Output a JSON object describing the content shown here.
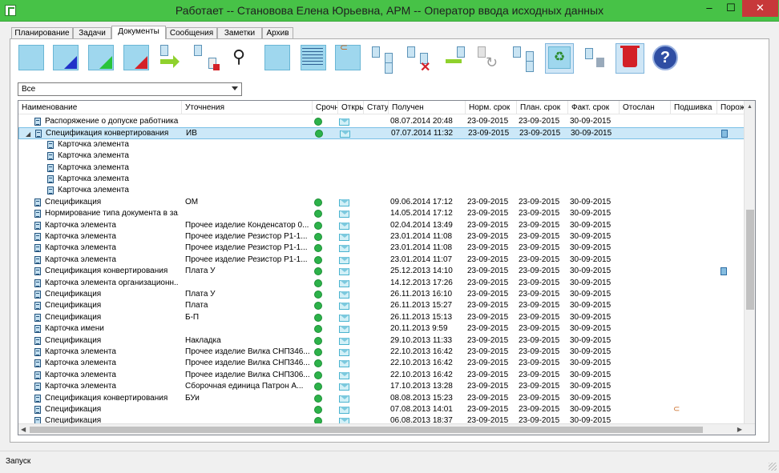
{
  "window": {
    "title": "Работает -- Становова Елена Юрьевна,     АРМ -- Оператор ввода исходных данных",
    "minimize": "–",
    "maximize": "☐",
    "close": "✕"
  },
  "tabs": [
    {
      "label": "Планирование"
    },
    {
      "label": "Задачи"
    },
    {
      "label": "Документы",
      "active": true
    },
    {
      "label": "Сообщения"
    },
    {
      "label": "Заметки"
    },
    {
      "label": "Архив"
    }
  ],
  "toolbar": {
    "icons": [
      "envelope-icon",
      "new-doc-blue-icon",
      "new-doc-green-icon",
      "new-doc-red-icon",
      "send-icon",
      "assign-icon",
      "binoculars-icon",
      "blank-icon",
      "list-icon",
      "attach-icon",
      "route-icon",
      "route-delete-icon",
      "receive-icon",
      "refresh-icon",
      "tree-icon",
      "recycle-icon",
      "trash-small-icon",
      "trash-icon",
      "help-icon"
    ]
  },
  "filter": {
    "value": "Все"
  },
  "grid": {
    "columns": [
      "Наименование",
      "Уточнения",
      "Срочн",
      "Откры",
      "Статус",
      "Получен",
      "Норм. срок",
      "План. срок",
      "Факт. срок",
      "Отослан",
      "Подшивка",
      "Порож"
    ],
    "rows": [
      {
        "name": "Распоряжение о допуске работника ...",
        "spec": "",
        "urgent": true,
        "open": true,
        "received": "08.07.2014 20:48",
        "norm": "23-09-2015",
        "plan": "23-09-2015",
        "fact": "30-09-2015",
        "indent": 1
      },
      {
        "name": "Спецификация конвертирования",
        "spec": "ИВ",
        "urgent": true,
        "open": true,
        "received": "07.07.2014 11:32",
        "norm": "23-09-2015",
        "plan": "23-09-2015",
        "fact": "30-09-2015",
        "indent": 1,
        "selected": true,
        "expanded": true,
        "pair": true
      },
      {
        "name": "Карточка элемента",
        "spec": "",
        "indent": 2
      },
      {
        "name": "Карточка элемента",
        "spec": "",
        "indent": 2
      },
      {
        "name": "Карточка элемента",
        "spec": "",
        "indent": 2
      },
      {
        "name": "Карточка элемента",
        "spec": "",
        "indent": 2
      },
      {
        "name": "Карточка элемента",
        "spec": "",
        "indent": 2
      },
      {
        "name": "Спецификация",
        "spec": "ОМ",
        "urgent": true,
        "open": true,
        "received": "09.06.2014 17:12",
        "norm": "23-09-2015",
        "plan": "23-09-2015",
        "fact": "30-09-2015",
        "indent": 1
      },
      {
        "name": "Нормирование типа документа в за...",
        "spec": "",
        "urgent": true,
        "open": true,
        "received": "14.05.2014 17:12",
        "norm": "23-09-2015",
        "plan": "23-09-2015",
        "fact": "30-09-2015",
        "indent": 1
      },
      {
        "name": "Карточка элемента",
        "spec": "Прочее изделие   Конденсатор   0...",
        "urgent": true,
        "open": true,
        "received": "02.04.2014 13:49",
        "norm": "23-09-2015",
        "plan": "23-09-2015",
        "fact": "30-09-2015",
        "indent": 1
      },
      {
        "name": "Карточка элемента",
        "spec": "Прочее изделие   Резистор   Р1-1...",
        "urgent": true,
        "open": true,
        "received": "23.01.2014 11:08",
        "norm": "23-09-2015",
        "plan": "23-09-2015",
        "fact": "30-09-2015",
        "indent": 1
      },
      {
        "name": "Карточка элемента",
        "spec": "Прочее изделие   Резистор   Р1-1...",
        "urgent": true,
        "open": true,
        "received": "23.01.2014 11:08",
        "norm": "23-09-2015",
        "plan": "23-09-2015",
        "fact": "30-09-2015",
        "indent": 1
      },
      {
        "name": "Карточка элемента",
        "spec": "Прочее изделие   Резистор   Р1-1...",
        "urgent": true,
        "open": true,
        "received": "23.01.2014 11:07",
        "norm": "23-09-2015",
        "plan": "23-09-2015",
        "fact": "30-09-2015",
        "indent": 1
      },
      {
        "name": "Спецификация конвертирования",
        "spec": "Плата У",
        "urgent": true,
        "open": true,
        "received": "25.12.2013 14:10",
        "norm": "23-09-2015",
        "plan": "23-09-2015",
        "fact": "30-09-2015",
        "indent": 1,
        "pair": true
      },
      {
        "name": "Карточка элемента организационн...",
        "spec": "",
        "urgent": true,
        "open": true,
        "received": "14.12.2013 17:26",
        "norm": "23-09-2015",
        "plan": "23-09-2015",
        "fact": "30-09-2015",
        "indent": 1
      },
      {
        "name": "Спецификация",
        "spec": "Плата У",
        "urgent": true,
        "open": true,
        "received": "26.11.2013 16:10",
        "norm": "23-09-2015",
        "plan": "23-09-2015",
        "fact": "30-09-2015",
        "indent": 1
      },
      {
        "name": "Спецификация",
        "spec": "Плата",
        "urgent": true,
        "open": true,
        "received": "26.11.2013 15:27",
        "norm": "23-09-2015",
        "plan": "23-09-2015",
        "fact": "30-09-2015",
        "indent": 1
      },
      {
        "name": "Спецификация",
        "spec": "Б-П",
        "urgent": true,
        "open": true,
        "received": "26.11.2013 15:13",
        "norm": "23-09-2015",
        "plan": "23-09-2015",
        "fact": "30-09-2015",
        "indent": 1
      },
      {
        "name": "Карточка имени",
        "spec": "",
        "urgent": true,
        "open": true,
        "received": "20.11.2013 9:59",
        "norm": "23-09-2015",
        "plan": "23-09-2015",
        "fact": "30-09-2015",
        "indent": 1
      },
      {
        "name": "Спецификация",
        "spec": "Накладка",
        "urgent": true,
        "open": true,
        "received": "29.10.2013 11:33",
        "norm": "23-09-2015",
        "plan": "23-09-2015",
        "fact": "30-09-2015",
        "indent": 1
      },
      {
        "name": "Карточка элемента",
        "spec": "Прочее изделие   Вилка   СНП346...",
        "urgent": true,
        "open": true,
        "received": "22.10.2013 16:42",
        "norm": "23-09-2015",
        "plan": "23-09-2015",
        "fact": "30-09-2015",
        "indent": 1
      },
      {
        "name": "Карточка элемента",
        "spec": "Прочее изделие   Вилка   СНП346...",
        "urgent": true,
        "open": true,
        "received": "22.10.2013 16:42",
        "norm": "23-09-2015",
        "plan": "23-09-2015",
        "fact": "30-09-2015",
        "indent": 1
      },
      {
        "name": "Карточка элемента",
        "spec": "Прочее изделие   Вилка   СНП306...",
        "urgent": true,
        "open": true,
        "received": "22.10.2013 16:42",
        "norm": "23-09-2015",
        "plan": "23-09-2015",
        "fact": "30-09-2015",
        "indent": 1
      },
      {
        "name": "Карточка элемента",
        "spec": "Сборочная единица   Патрон   А...",
        "urgent": true,
        "open": true,
        "received": "17.10.2013 13:28",
        "norm": "23-09-2015",
        "plan": "23-09-2015",
        "fact": "30-09-2015",
        "indent": 1
      },
      {
        "name": "Спецификация конвертирования",
        "spec": "БУи",
        "urgent": true,
        "open": true,
        "received": "08.08.2013 15:23",
        "norm": "23-09-2015",
        "plan": "23-09-2015",
        "fact": "30-09-2015",
        "indent": 1
      },
      {
        "name": "Спецификация",
        "spec": "",
        "urgent": true,
        "open": true,
        "received": "07.08.2013 14:01",
        "norm": "23-09-2015",
        "plan": "23-09-2015",
        "fact": "30-09-2015",
        "indent": 1,
        "clip": true
      },
      {
        "name": "Спецификация",
        "spec": "",
        "urgent": true,
        "open": true,
        "received": "06.08.2013 18:37",
        "norm": "23-09-2015",
        "plan": "23-09-2015",
        "fact": "30-09-2015",
        "indent": 1
      }
    ]
  },
  "status": {
    "text": "Запуск"
  }
}
